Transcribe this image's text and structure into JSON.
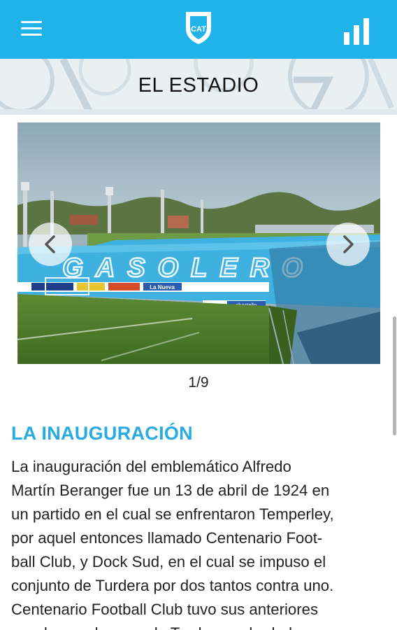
{
  "header": {
    "logo_letters": "CAT",
    "menu_icon": "hamburger-menu-icon",
    "stats_icon": "bar-chart-icon",
    "brand_color": "#1fb3ea"
  },
  "banner": {
    "title": "EL ESTADIO"
  },
  "gallery": {
    "current_slide": 1,
    "total_slides": 9,
    "counter": "1/9",
    "stand_text": "GASOLERO",
    "sign_texts": [
      "La Nueva",
      "ebestello"
    ]
  },
  "section": {
    "heading": "LA INAUGURACIÓN",
    "heading_color": "#29abe2",
    "body_lines": [
      "La inauguración del emblemático Alfredo",
      "Martín Beranger fue un 13 de abril de 1924 en",
      "un partido en el cual se enfrentaron Temperley,",
      "por aquel entonces llamado Centenario Foot-",
      "ball Club, y Dock Sud, en el cual se impuso el",
      "conjunto de Turdera por dos tantos contra uno.",
      "Centenario Football Club tuvo sus anteriores",
      "canchas en la zona de Turdera y alrededores"
    ]
  }
}
